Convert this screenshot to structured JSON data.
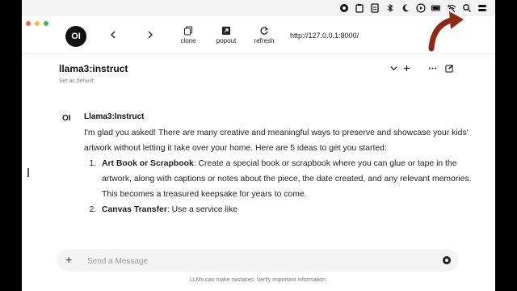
{
  "browser": {
    "clone_label": "clone",
    "popout_label": "popout",
    "refresh_label": "refresh",
    "url": "http://127.0.0.1:8000/",
    "logo_text": "OI"
  },
  "header": {
    "model_title": "llama3:instruct",
    "set_default": "Set as default"
  },
  "chat": {
    "avatar_text": "OI",
    "sender": "Llama3:Instruct",
    "intro": "I'm glad you asked! There are many creative and meaningful ways to preserve and showcase your kids' artwork without letting it take over your home. Here are 5 ideas to get you started:",
    "items": [
      {
        "title": "Art Book or Scrapbook",
        "text": ": Create a special book or scrapbook where you can glue or tape in the artwork, along with captions or notes about the piece, the date created, and any relevant memories. This becomes a treasured keepsake for years to come."
      },
      {
        "title": "Canvas Transfer",
        "text": ": Use a service like"
      }
    ]
  },
  "composer": {
    "placeholder": "Send a Message",
    "disclaimer": "LLMs can make mistakes. Verify important information."
  },
  "colors": {
    "close": "#ff5f57",
    "minimize": "#febc2e",
    "maximize": "#28c840",
    "annotation_arrow": "#8b2a16"
  }
}
